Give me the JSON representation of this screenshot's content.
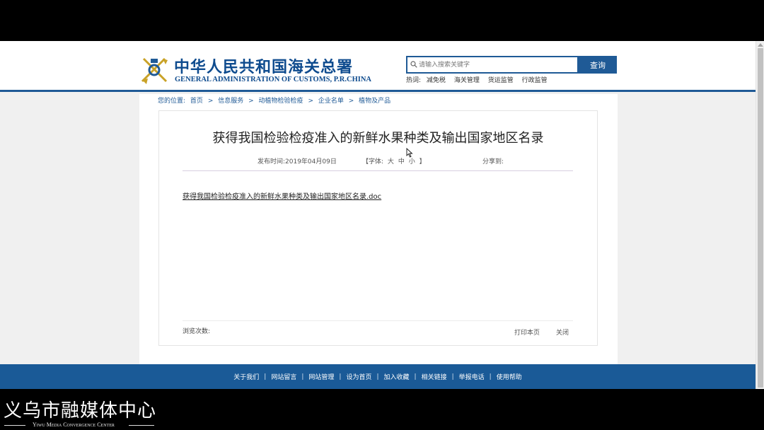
{
  "header": {
    "logo_cn": "中华人民共和国海关总署",
    "logo_en": "GENERAL ADMINISTRATION OF CUSTOMS, P.R.CHINA",
    "search_placeholder": "请输入搜索关键字",
    "search_button": "查询",
    "hot_label": "热词:",
    "hot_words": [
      "减免税",
      "海关管理",
      "货运监管",
      "行政监管"
    ]
  },
  "breadcrumb": {
    "prefix": "您的位置:",
    "items": [
      "首页",
      "信息服务",
      "动植物检验检疫",
      "企业名单",
      "植物及产品"
    ],
    "separator": ">"
  },
  "article": {
    "title": "获得我国检验检疫准入的新鲜水果种类及输出国家地区名录",
    "date_label": "发布时间:2019年04月09日",
    "font_open": "【字体:",
    "font_large": "大",
    "font_medium": "中",
    "font_small": "小",
    "font_close": "】",
    "share_label": "分享到:",
    "attachment": "获得我国检验检疫准入的新鲜水果种类及输出国家地区名录.doc",
    "view_count_label": "浏览次数:",
    "print_label": "打印本页",
    "close_label": "关闭"
  },
  "footer": {
    "links": [
      "关于我们",
      "网站留言",
      "网站管理",
      "设为首页",
      "加入收藏",
      "相关链接",
      "举报电话",
      "使用帮助"
    ],
    "separator": "|"
  },
  "watermark": {
    "cn": "义乌市融媒体中心",
    "en": "Yiwu Media Convergence Center"
  },
  "colors": {
    "brand_blue": "#1f5a96",
    "footer_blue": "#1a5a97",
    "logo_blue": "#0e4b8e",
    "emblem_gold": "#c9a227"
  },
  "icons": {
    "logo": "customs-emblem-icon",
    "search": "search-icon",
    "cursor": "mouse-pointer-icon"
  }
}
